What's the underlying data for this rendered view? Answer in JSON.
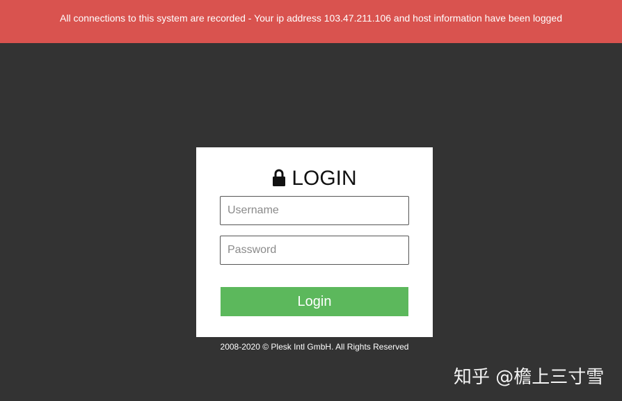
{
  "banner": {
    "text": "All connections to this system are recorded - Your ip address 103.47.211.106 and host information have been logged",
    "color": "#d9534f"
  },
  "login_card": {
    "title": "LOGIN",
    "title_icon": "lock-icon",
    "username_placeholder": "Username",
    "username_value": "",
    "password_placeholder": "Password",
    "password_value": "",
    "submit_label": "Login",
    "submit_color": "#5cb85c"
  },
  "footer": {
    "text": "2008-2020 © Plesk Intl GmbH. All Rights Reserved"
  },
  "watermark": {
    "text": "知乎 @檐上三寸雪"
  }
}
